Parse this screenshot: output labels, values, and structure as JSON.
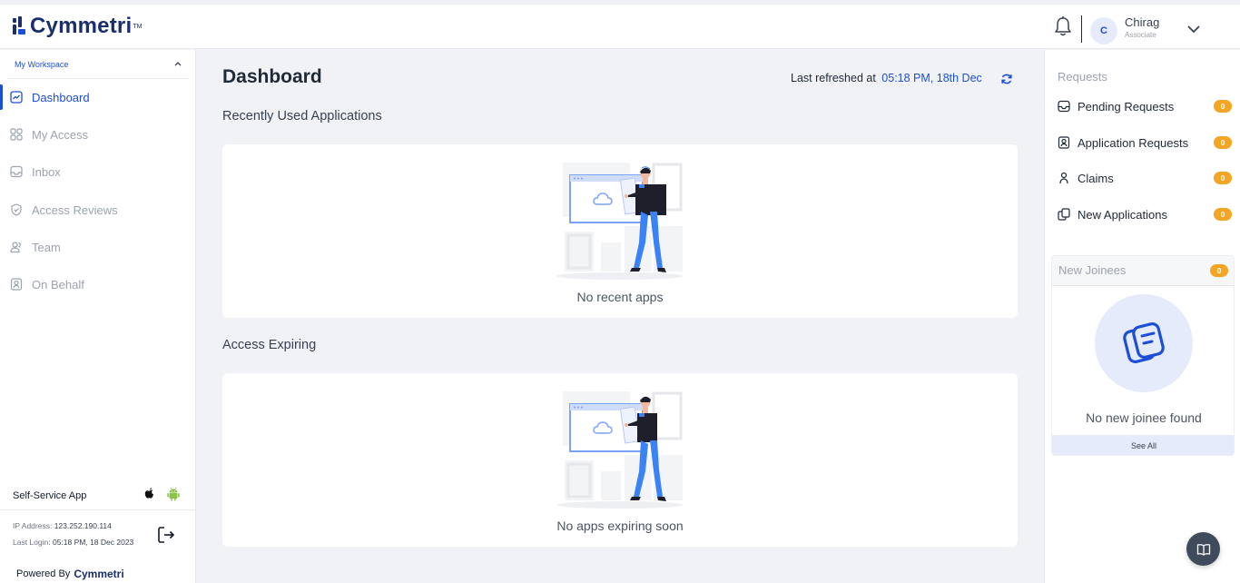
{
  "brand": {
    "name": "Cymmetri",
    "tm": "TM",
    "color": "#1a2e6e"
  },
  "header": {
    "notification_icon": "bell-icon",
    "user": {
      "initial": "C",
      "name": "Chirag",
      "role": "Associate"
    },
    "menu_icon": "chevron-down-icon"
  },
  "sidebar": {
    "workspace_label": "My Workspace",
    "items": [
      {
        "label": "Dashboard",
        "icon": "dashboard-icon",
        "active": true
      },
      {
        "label": "My Access",
        "icon": "grid-icon",
        "active": false
      },
      {
        "label": "Inbox",
        "icon": "inbox-icon",
        "active": false
      },
      {
        "label": "Access Reviews",
        "icon": "shield-check-icon",
        "active": false
      },
      {
        "label": "Team",
        "icon": "team-icon",
        "active": false
      },
      {
        "label": "On Behalf",
        "icon": "on-behalf-icon",
        "active": false
      }
    ],
    "self_service_label": "Self-Service App",
    "ip_label": "IP Address:",
    "ip_value": "123.252.190.114",
    "last_login_label": "Last Login:",
    "last_login_value": "05:18 PM, 18 Dec 2023",
    "powered_by": "Powered By"
  },
  "main": {
    "title": "Dashboard",
    "refresh_label": "Last refreshed at",
    "refresh_time": "05:18 PM, 18th Dec",
    "sections": [
      {
        "title": "Recently Used Applications",
        "empty_text": "No recent apps"
      },
      {
        "title": "Access Expiring",
        "empty_text": "No apps expiring soon"
      }
    ]
  },
  "requests": {
    "title": "Requests",
    "items": [
      {
        "label": "Pending Requests",
        "count": "0",
        "icon": "pending-requests-icon"
      },
      {
        "label": "Application Requests",
        "count": "0",
        "icon": "application-requests-icon"
      },
      {
        "label": "Claims",
        "count": "0",
        "icon": "claims-icon"
      },
      {
        "label": "New Applications",
        "count": "0",
        "icon": "new-applications-icon"
      }
    ]
  },
  "new_joinees": {
    "title": "New Joinees",
    "count": "0",
    "empty_text": "No new joinee found",
    "see_all": "See All"
  },
  "colors": {
    "accent": "#1d4ed8",
    "badge": "#f5a524",
    "muted": "#9ca3af"
  }
}
